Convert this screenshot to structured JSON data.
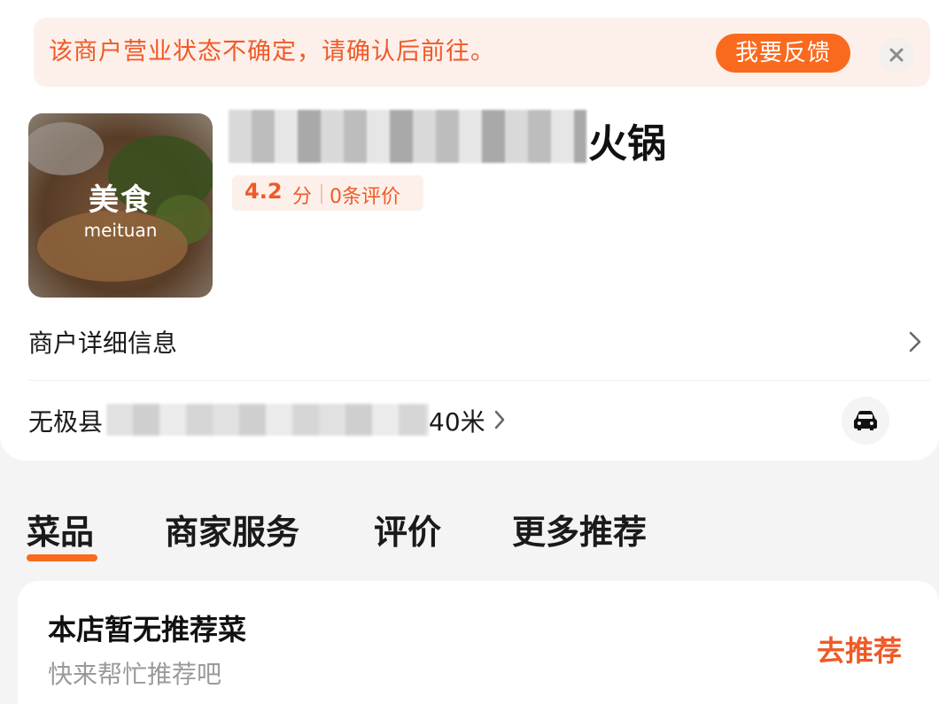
{
  "notice": {
    "text": "该商户营业状态不确定，请确认后前往。",
    "feedback_label": "我要反馈",
    "close_icon": "close-icon"
  },
  "store": {
    "cover_title": "美食",
    "cover_subtitle": "meituan",
    "name_suffix": "火锅",
    "rating_score": "4.2",
    "rating_unit": "分",
    "review_count": "0条评价"
  },
  "details": {
    "label": "商户详细信息"
  },
  "address": {
    "prefix": "无极县",
    "distance": "40米"
  },
  "tabs": [
    {
      "label": "菜品",
      "active": true
    },
    {
      "label": "商家服务",
      "active": false
    },
    {
      "label": "评价",
      "active": false
    },
    {
      "label": "更多推荐",
      "active": false
    }
  ],
  "recommend": {
    "title": "本店暂无推荐菜",
    "subtitle": "快来帮忙推荐吧",
    "action": "去推荐"
  },
  "colors": {
    "accent": "#fa6a1e",
    "accent_text": "#ef5a28",
    "notice_bg": "#fdf0ea"
  }
}
